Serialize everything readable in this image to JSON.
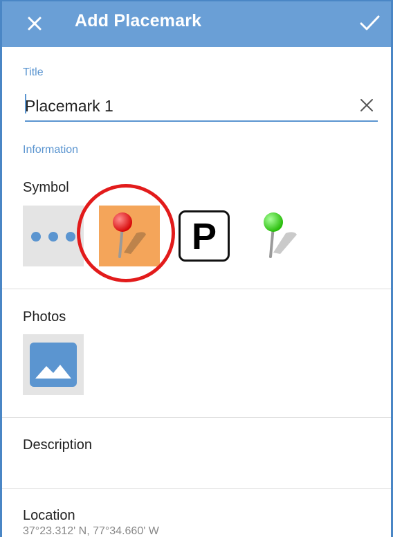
{
  "topbar": {
    "title": "Add Placemark",
    "close_icon": "close-icon",
    "confirm_icon": "check-icon",
    "background": "#6a9fd6"
  },
  "title_field": {
    "label": "Title",
    "value": "Placemark 1",
    "clear_icon": "clear-icon"
  },
  "information": {
    "label": "Information"
  },
  "symbol": {
    "label": "Symbol",
    "options": [
      {
        "name": "more-symbols",
        "icon": "ellipsis-icon"
      },
      {
        "name": "red-pin",
        "icon": "red-pushpin-icon",
        "selected": true,
        "selected_bg": "#f4a55a"
      },
      {
        "name": "parking",
        "text": "P"
      },
      {
        "name": "green-pin",
        "icon": "green-pushpin-icon"
      }
    ],
    "highlight_color": "#e21b1b"
  },
  "photos": {
    "label": "Photos",
    "add_icon": "image-icon"
  },
  "description": {
    "label": "Description"
  },
  "location": {
    "label": "Location",
    "value": "37°23.312' N, 77°34.660' W"
  }
}
